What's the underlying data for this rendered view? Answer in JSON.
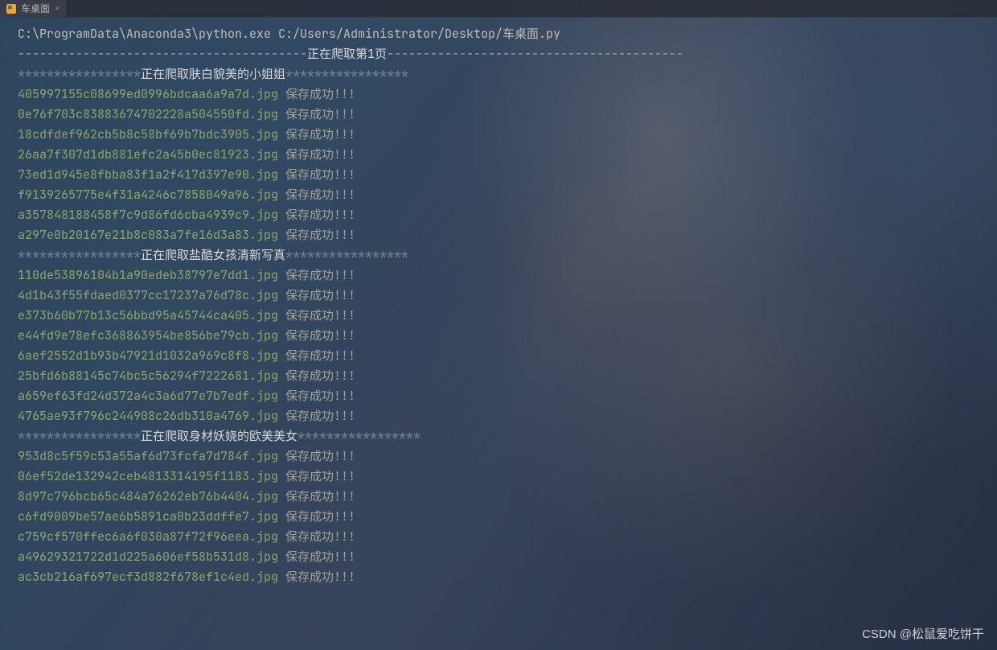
{
  "tab": {
    "title": "车桌面"
  },
  "command": "C:\\ProgramData\\Anaconda3\\python.exe C:/Users/Administrator/Desktop/车桌面.py",
  "page_header": {
    "prefix_dashes": 40,
    "text": "正在爬取第1页",
    "suffix_dashes": 41
  },
  "save_success": "保存成功!!!",
  "stars17": "*****************",
  "sections": [
    {
      "header": "正在爬取肤白貌美的小姐姐",
      "files": [
        "405997155c08699ed0996bdcaa6a9a7d.jpg",
        "0e76f703c83883674702228a504550fd.jpg",
        "18cdfdef962cb5b8c58bf69b7bdc3905.jpg",
        "26aa7f307d1db881efc2a45b0ec81923.jpg",
        "73ed1d945e8fbba83f1a2f417d397e90.jpg",
        "f9139265775e4f31a4246c7858049a96.jpg",
        "a357848188458f7c9d86fd6cba4939c9.jpg",
        "a297e0b20167e21b8c083a7fe16d3a83.jpg"
      ]
    },
    {
      "header": "正在爬取盐酷女孩清新写真",
      "files": [
        "110de53896104b1a90edeb38797e7dd1.jpg",
        "4d1b43f55fdaed0377cc17237a76d78c.jpg",
        "e373b60b77b13c56bbd95a45744ca405.jpg",
        "e44fd9e78efc368863954be856be79cb.jpg",
        "6aef2552d1b93b47921d1032a969c8f8.jpg",
        "25bfd6b88145c74bc5c56294f7222681.jpg",
        "a659ef63fd24d372a4c3a6d77e7b7edf.jpg",
        "4765ae93f796c244908c26db310a4769.jpg"
      ]
    },
    {
      "header": "正在爬取身材妖娆的欧美美女",
      "files": [
        "953d8c5f59c53a55af6d73fcfa7d784f.jpg",
        "06ef52de132942ceb4813314195f1183.jpg",
        "8d97c796bcb65c484a76262eb76b4404.jpg",
        "c6fd9009be57ae6b5891ca0b23ddffe7.jpg",
        "c759cf570ffec6a6f030a87f72f96eea.jpg",
        "a49629321722d1d225a606ef58b531d8.jpg",
        "ac3cb216af697ecf3d882f678ef1c4ed.jpg"
      ]
    }
  ],
  "watermark": "CSDN @松鼠爱吃饼干"
}
